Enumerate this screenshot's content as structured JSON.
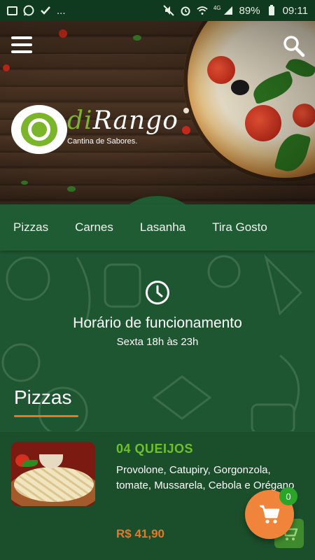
{
  "status_bar": {
    "notification_icons": [
      "image-icon",
      "whatsapp-icon",
      "checklist-icon"
    ],
    "more": "...",
    "network": "4G",
    "battery": "89%",
    "time": "09:11"
  },
  "header": {
    "logo_name_prefix": "di",
    "logo_name_suffix": "Rango",
    "logo_tagline": "Cantina de Sabores.",
    "menu_icon": "hamburger-menu-icon",
    "search_icon": "search-icon"
  },
  "categories": [
    "Pizzas",
    "Carnes",
    "Lasanha",
    "Tira Gosto"
  ],
  "hours": {
    "icon": "clock-icon",
    "title": "Horário de funcionamento",
    "schedule": "Sexta 18h às 23h"
  },
  "section": {
    "title": "Pizzas"
  },
  "products": [
    {
      "name": "04 QUEIJOS",
      "description": "Provolone, Catupiry, Gorgonzola, tomate, Mussarela, Cebola e Orégano",
      "price": "R$ 41,90"
    }
  ],
  "cart": {
    "icon": "cart-icon",
    "count": "0"
  },
  "colors": {
    "primary": "#1e5a32",
    "accent": "#e07b2c",
    "product_name": "#6cc22a"
  }
}
